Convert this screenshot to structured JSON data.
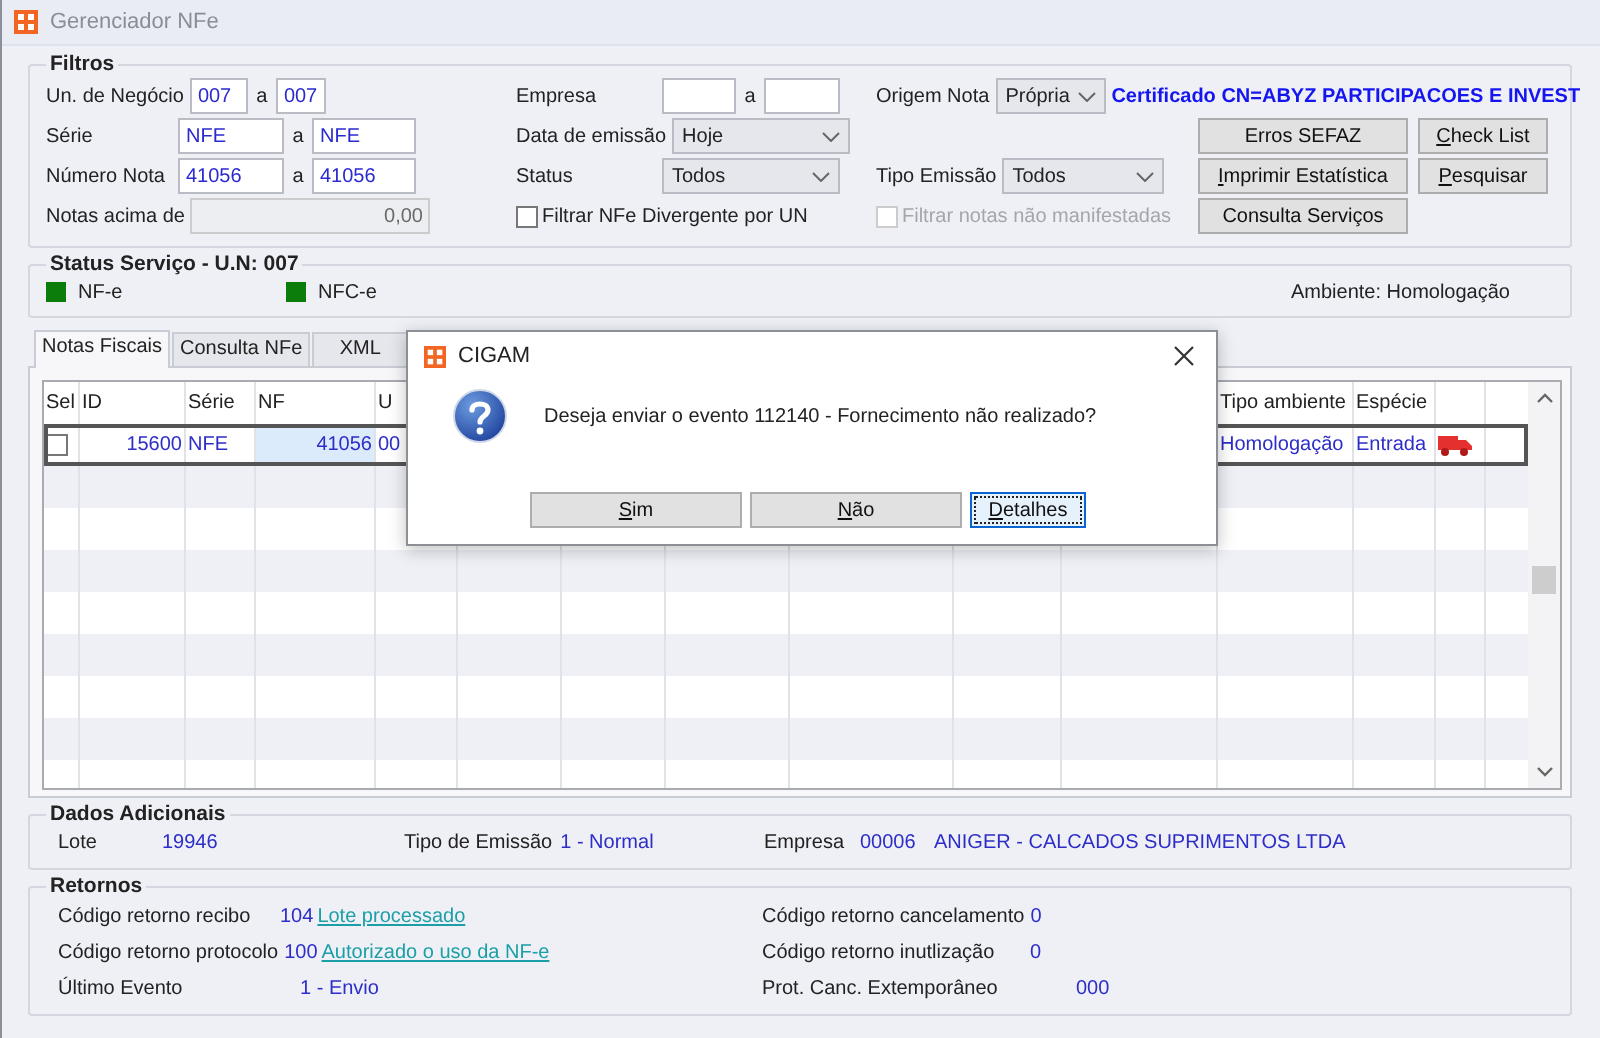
{
  "window": {
    "title": "Gerenciador NFe"
  },
  "filters": {
    "title": "Filtros",
    "ranges": [
      {
        "label": "Un. de Negócio",
        "from": "007",
        "separator": "a",
        "to": "007"
      },
      {
        "label": "Série",
        "from": "NFE",
        "separator": "a",
        "to": "NFE"
      },
      {
        "label": "Número Nota",
        "from": "41056",
        "separator": "a",
        "to": "41056"
      }
    ],
    "notas_acima": {
      "label": "Notas acima de",
      "value": "0,00",
      "disabled": true
    },
    "empresa": {
      "label": "Empresa",
      "separator": "a"
    },
    "selects": [
      {
        "label": "Data de emissão",
        "value": "Hoje"
      },
      {
        "label": "Status",
        "value": "Todos"
      }
    ],
    "divergente": {
      "label": "Filtrar NFe Divergente por UN",
      "checked": false,
      "disabled": false
    },
    "origem": {
      "label": "Origem Nota",
      "value": "Própria"
    },
    "certificate": "Certificado CN=ABYZ PARTICIPACOES E INVEST",
    "tipo_emissao": {
      "label": "Tipo Emissão",
      "value": "Todos"
    },
    "manifestadas": {
      "label": "Filtrar notas não manifestadas",
      "checked": false,
      "disabled": true
    },
    "buttons": [
      {
        "label": "Erros SEFAZ",
        "access_key": false
      },
      {
        "label": "Check List",
        "access_key": true
      },
      {
        "label": "Imprimir Estatística",
        "access_key": true
      },
      {
        "label": "Pesquisar",
        "access_key": true
      },
      {
        "label": "Consulta Serviços",
        "access_key": false
      }
    ]
  },
  "status_servico": {
    "title": "Status Serviço - U.N: 007",
    "services": [
      {
        "label": "NF-e",
        "color": "#0b7d0b"
      },
      {
        "label": "NFC-e",
        "color": "#0b7d0b"
      }
    ],
    "ambiente": "Ambiente: Homologação"
  },
  "tabs": [
    {
      "label": "Notas Fiscais",
      "selected": true
    },
    {
      "label": "Consulta NFe",
      "selected": false
    },
    {
      "label": "XML",
      "selected": false
    }
  ],
  "table": {
    "columns": [
      "Sel",
      "ID",
      "Série",
      "NF",
      "U",
      "Tipo ambiente",
      "Espécie"
    ],
    "rows": [
      {
        "selected": true,
        "cells": [
          {
            "kind": "checkbox",
            "checked": false,
            "focused": false
          },
          {
            "text": "15600",
            "focused": false
          },
          {
            "text": "NFE",
            "focused": false
          },
          {
            "text": "41056",
            "focused": true
          },
          {
            "text": "00",
            "focused": false
          },
          {
            "text": "Homologação",
            "focused": false
          },
          {
            "text": "Entrada",
            "focused": false
          }
        ]
      }
    ]
  },
  "dados_adicionais": {
    "title": "Dados Adicionais",
    "fields": [
      {
        "label": "Lote",
        "value": "19946"
      },
      {
        "label": "Tipo de Emissão",
        "value": "1 - Normal"
      },
      {
        "label": "Empresa",
        "value": "00006",
        "name": "ANIGER - CALCADOS SUPRIMENTOS LTDA"
      }
    ]
  },
  "retornos": {
    "title": "Retornos",
    "left": [
      {
        "label": "Código retorno recibo",
        "code": "104",
        "link": "Lote processado"
      },
      {
        "label": "Código retorno protocolo",
        "code": "100",
        "link": "Autorizado o uso da NF-e"
      },
      {
        "label": "Último Evento",
        "code": "1 - Envio"
      }
    ],
    "right": [
      {
        "label": "Código retorno cancelamento",
        "code": "0"
      },
      {
        "label": "Código retorno inutlização",
        "code": "0"
      },
      {
        "label": "Prot. Canc. Extemporâneo",
        "code": "000"
      }
    ]
  },
  "dialog": {
    "title": "CIGAM",
    "message": "Deseja enviar o evento 112140 - Fornecimento não realizado?",
    "buttons": [
      {
        "label": "Sim",
        "access_key": true,
        "focused": false
      },
      {
        "label": "Não",
        "access_key": true,
        "focused": false
      },
      {
        "label": "Detalhes",
        "access_key": true,
        "focused": true
      }
    ]
  }
}
